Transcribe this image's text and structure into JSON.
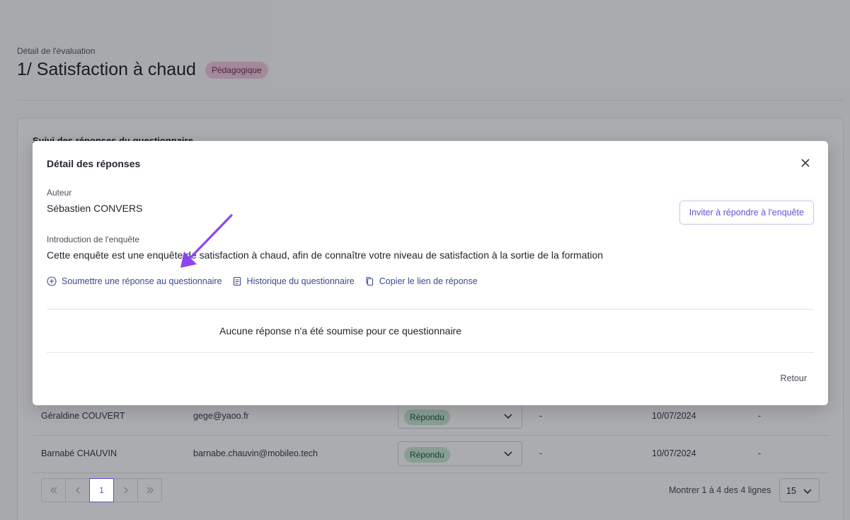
{
  "page": {
    "subtitle": "Détail de l'évaluation",
    "title": "1/ Satisfaction à chaud",
    "badge": "Pédagogique",
    "card_title": "Suivi des réponses du questionnaire"
  },
  "table": {
    "rows": [
      {
        "name": "Géraldine COUVERT",
        "email": "gege@yaoo.fr",
        "status": "Répondu",
        "col4": "-",
        "date": "10/07/2024",
        "col6": "-"
      },
      {
        "name": "Barnabé CHAUVIN",
        "email": "barnabe.chauvin@mobileo.tech",
        "status": "Répondu",
        "col4": "-",
        "date": "10/07/2024",
        "col6": "-"
      }
    ]
  },
  "pagination": {
    "pages": [
      "1"
    ],
    "current": "1",
    "info": "Montrer 1 à 4 des 4 lignes",
    "per_page": "15"
  },
  "modal": {
    "title": "Détail des réponses",
    "author_label": "Auteur",
    "author_value": "Sébastien CONVERS",
    "invite_button": "Inviter à répondre à l'enquête",
    "intro_label": "Introduction de l'enquête",
    "intro_value": "Cette enquête est une enquête de satisfaction à chaud, afin de connaître votre niveau de satisfaction à la sortie de la formation",
    "actions": {
      "submit": "Soumettre une réponse au questionnaire",
      "history": "Historique du questionnaire",
      "copy_link": "Copier le lien de réponse"
    },
    "empty_message": "Aucune réponse n'a été soumise pour ce questionnaire",
    "back_button": "Retour"
  },
  "colors": {
    "accent": "#6a4fd6",
    "link": "#3a4a8f",
    "annotation_arrow": "#8b46f0",
    "badge_pink": "#f3c9dd",
    "status_green": "#c7e9d5"
  }
}
